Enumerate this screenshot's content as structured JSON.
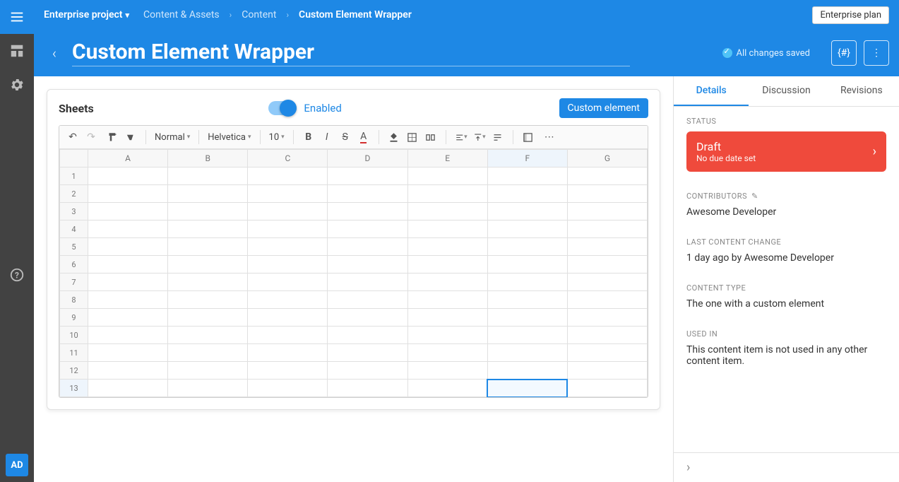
{
  "topbar": {
    "project": "Enterprise project",
    "plan": "Enterprise plan"
  },
  "breadcrumbs": [
    "Content & Assets",
    "Content",
    "Custom Element Wrapper"
  ],
  "hero": {
    "title": "Custom Element Wrapper",
    "save_status": "All changes saved",
    "codename_icon": "{#}",
    "more_icon": "⋮"
  },
  "rail": {
    "avatar": "AD"
  },
  "card": {
    "label": "Sheets",
    "toggle_label": "Enabled",
    "custom_button": "Custom element"
  },
  "sheet_toolbar": {
    "style_select": "Normal",
    "font_select": "Helvetica",
    "size_select": "10"
  },
  "sheet": {
    "columns": [
      "A",
      "B",
      "C",
      "D",
      "E",
      "F",
      "G"
    ],
    "rows": [
      1,
      2,
      3,
      4,
      5,
      6,
      7,
      8,
      9,
      10,
      11,
      12,
      13
    ],
    "selected": {
      "row": 13,
      "col": "F"
    }
  },
  "sidebar": {
    "tabs": [
      "Details",
      "Discussion",
      "Revisions"
    ],
    "active_tab": 0,
    "status": {
      "heading": "STATUS",
      "title": "Draft",
      "subtitle": "No due date set"
    },
    "contributors": {
      "heading": "CONTRIBUTORS",
      "value": "Awesome Developer"
    },
    "last_change": {
      "heading": "LAST CONTENT CHANGE",
      "value": "1 day ago by Awesome Developer"
    },
    "content_type": {
      "heading": "CONTENT TYPE",
      "value": "The one with a custom element"
    },
    "used_in": {
      "heading": "USED IN",
      "value": "This content item is not used in any other content item."
    }
  }
}
